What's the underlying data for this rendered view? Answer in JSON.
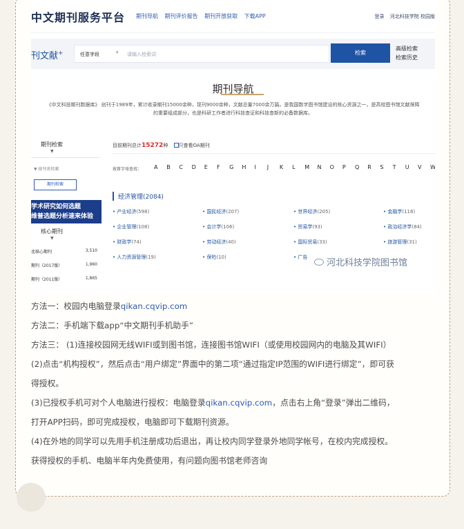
{
  "header": {
    "brand": "中文期刊服务平台",
    "nav": [
      "期刊导航",
      "期刊评价报告",
      "期刊开放获取",
      "下载APP"
    ],
    "right": [
      "登录",
      "河北科技学院 校园版"
    ]
  },
  "search": {
    "logo": "刊文献",
    "logo_sup": "+",
    "field": "任意字段",
    "placeholder": "请输入检索词",
    "button": "检索",
    "advanced": "高级检索",
    "history": "检索历史"
  },
  "page": {
    "title": "期刊导航",
    "intro_line1": "《中文科技期刊数据库》 创刊于1989年，累计收录期刊15000余种，现刊9000余种，文献总量7000余万篇。是我国数字图书馆建设的核心资源之一，是高校图书馆文献保障",
    "intro_line2": "的重要组成部分，也是科研工作者进行科技查证和科技查新的必备数据库。"
  },
  "left": {
    "head": "期刊检索",
    "arrow": "▼",
    "select": "▼  按刊名检索",
    "search_btn": "期刊检索",
    "banner_line1": "学术研究如何选题",
    "banner_line2": "维普选题分析速来体验",
    "core_head": "核心期刊",
    "core_arrow": "▼",
    "core_items": [
      {
        "label": "北核心期刊",
        "count": "3,510"
      },
      {
        "label": "期刊（2017版）",
        "count": "1,960"
      },
      {
        "label": "期刊（2011版）",
        "count": "1,865"
      }
    ]
  },
  "right": {
    "total_prefix": "目前期刊总计",
    "total": "15272",
    "total_suffix": "种",
    "oa_label": "只查看OA期刊",
    "alpha_label": "按首字母查找：",
    "letters": [
      "A",
      "B",
      "C",
      "D",
      "E",
      "F",
      "G",
      "H",
      "I",
      "J",
      "K",
      "L",
      "M",
      "N",
      "O",
      "P",
      "Q",
      "R",
      "S",
      "T",
      "U",
      "V",
      "W"
    ],
    "category": "经济管理(2084)",
    "items": [
      {
        "name": "产业经济",
        "count": "(598)"
      },
      {
        "name": "国民经济",
        "count": "(207)"
      },
      {
        "name": "世界经济",
        "count": "(205)"
      },
      {
        "name": "金融学",
        "count": "(118)"
      },
      {
        "name": "企业管理",
        "count": "(108)"
      },
      {
        "name": "会计学",
        "count": "(106)"
      },
      {
        "name": "贸易学",
        "count": "(93)"
      },
      {
        "name": "政治经济学",
        "count": "(84)"
      },
      {
        "name": "财政学",
        "count": "(74)"
      },
      {
        "name": "劳动经济",
        "count": "(40)"
      },
      {
        "name": "国际贸易",
        "count": "(33)"
      },
      {
        "name": "旅游管理",
        "count": "(31)"
      },
      {
        "name": "人力资源管理",
        "count": "(19)"
      },
      {
        "name": "保险",
        "count": "(10)"
      },
      {
        "name": "广告",
        "count": ""
      }
    ],
    "watermark": "河北科技学院图书馆"
  },
  "methods": {
    "m1_prefix": "方法一：校园内电脑登录",
    "m1_link": "qikan.cqvip.com",
    "m2": "方法二：手机端下载app“中文期刊手机助手”",
    "m3_line1": "方法三：  (1)连接校园网无线WIFI或到图书馆，连接图书馆WIFI（或使用校园网内的电脑及其WIFI）",
    "m3_line2": "(2)点击“机构授权”，然后点击“用户绑定”界面中的第二项“通过指定IP范围的WIFI进行绑定”，即可获",
    "m3_line3": "得授权。",
    "m3_line4_prefix": "(3)已授权手机可对个人电脑进行授权：电脑登录",
    "m3_line4_link": "qikan.cqvip.com",
    "m3_line4_suffix": "，点击右上角“登录”弹出二维码，",
    "m3_line5": "打开APP扫码，即可完成授权，电脑即可下载期刊资源。",
    "m3_line6": "(4)在外地的同学可以先用手机注册成功后退出，再让校内同学登录外地同学帐号，在校内完成授权。",
    "m3_line7": "获得授权的手机、电脑半年内免费使用，有问题向图书馆老师咨询"
  }
}
